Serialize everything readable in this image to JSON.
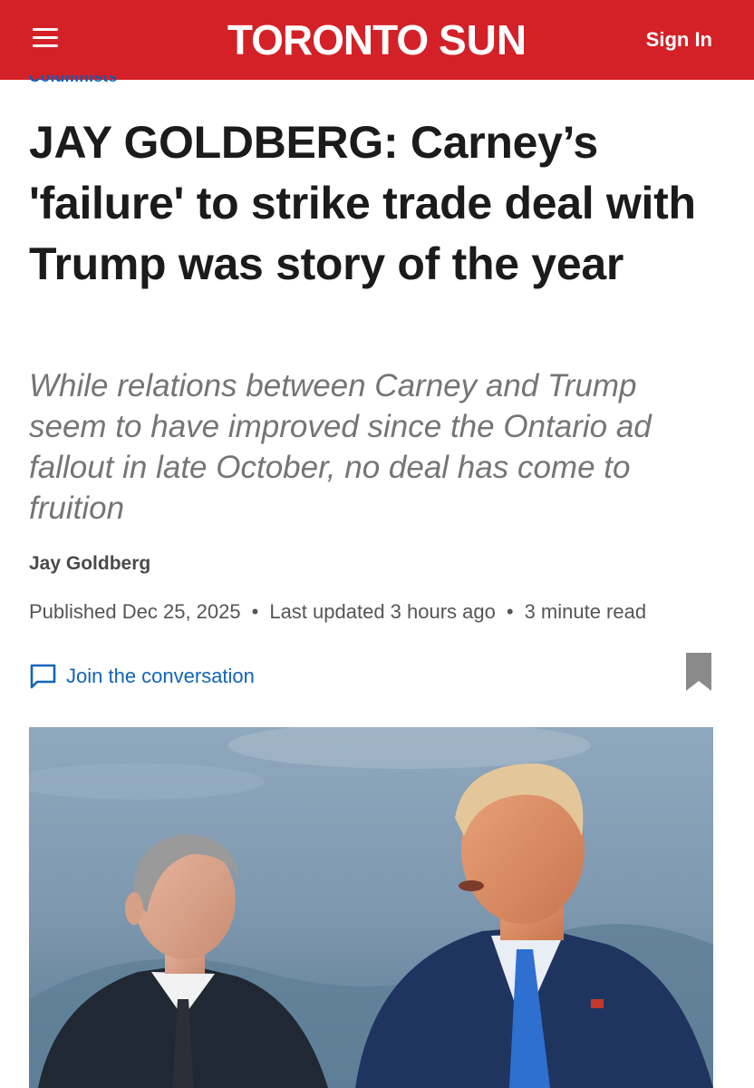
{
  "header": {
    "logo_left": "TORONTO",
    "logo_right": "SUN",
    "sign_in": "Sign In",
    "menu_icon": "hamburger-menu-icon",
    "brand_color": "#d42027"
  },
  "article": {
    "section": "Columnists",
    "headline": "JAY GOLDBERG: Carney’s 'failure' to strike trade deal with Trump was story of the year",
    "deck": "While relations between Carney and Trump seem to have improved since the Ontario ad fallout in late October, no deal has come to fruition",
    "author": "Jay Goldberg",
    "published": "Published Dec 25, 2025",
    "updated": "Last updated 3 hours ago",
    "read_time": "3 minute read",
    "separator": "•",
    "conversation_label": "Join the conversation",
    "conversation_icon": "comment-icon",
    "bookmark_icon": "bookmark-icon",
    "link_color": "#1264b8"
  }
}
